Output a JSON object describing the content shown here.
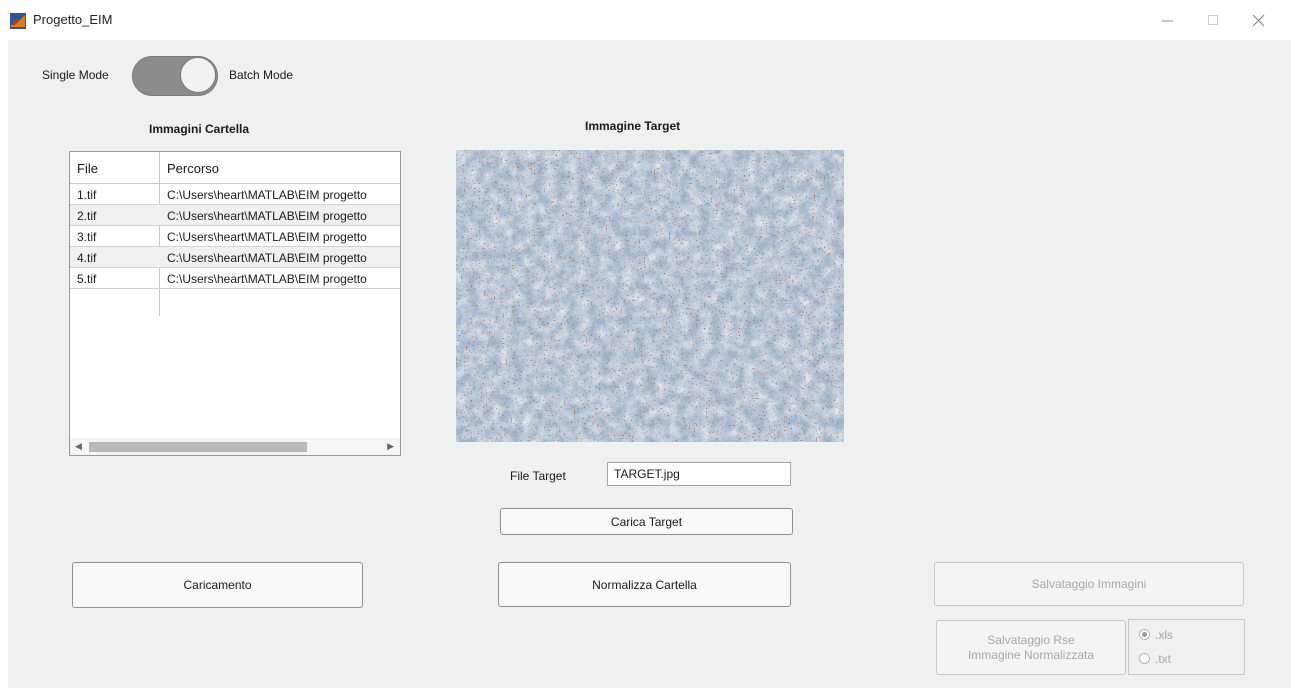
{
  "window": {
    "title": "Progetto_EIM",
    "icon": "matlab-icon"
  },
  "mode_toggle": {
    "left_label": "Single Mode",
    "right_label": "Batch Mode",
    "state": "Batch Mode"
  },
  "folder_panel": {
    "title": "Immagini Cartella",
    "columns": [
      "File",
      "Percorso"
    ],
    "rows": [
      {
        "file": "1.tif",
        "path": "C:\\Users\\heart\\MATLAB\\EIM progetto"
      },
      {
        "file": "2.tif",
        "path": "C:\\Users\\heart\\MATLAB\\EIM progetto"
      },
      {
        "file": "3.tif",
        "path": "C:\\Users\\heart\\MATLAB\\EIM progetto"
      },
      {
        "file": "4.tif",
        "path": "C:\\Users\\heart\\MATLAB\\EIM progetto"
      },
      {
        "file": "5.tif",
        "path": "C:\\Users\\heart\\MATLAB\\EIM progetto"
      }
    ]
  },
  "target_panel": {
    "title": "Immagine Target",
    "file_label": "File Target",
    "file_value": "TARGET.jpg",
    "load_button": "Carica Target"
  },
  "actions": {
    "load_button": "Caricamento",
    "normalize_button": "Normalizza Cartella",
    "save_images_button": "Salvataggio Immagini",
    "save_rse_line1": "Salvataggio Rse",
    "save_rse_line2": "Immagine Normalizzata",
    "formats": [
      {
        "label": ".xls",
        "selected": true
      },
      {
        "label": ".txt",
        "selected": false
      }
    ]
  },
  "colors": {
    "background": "#f0f0f0",
    "toggle_track": "#8c8c8c",
    "disabled_text": "#a8a8a8"
  }
}
